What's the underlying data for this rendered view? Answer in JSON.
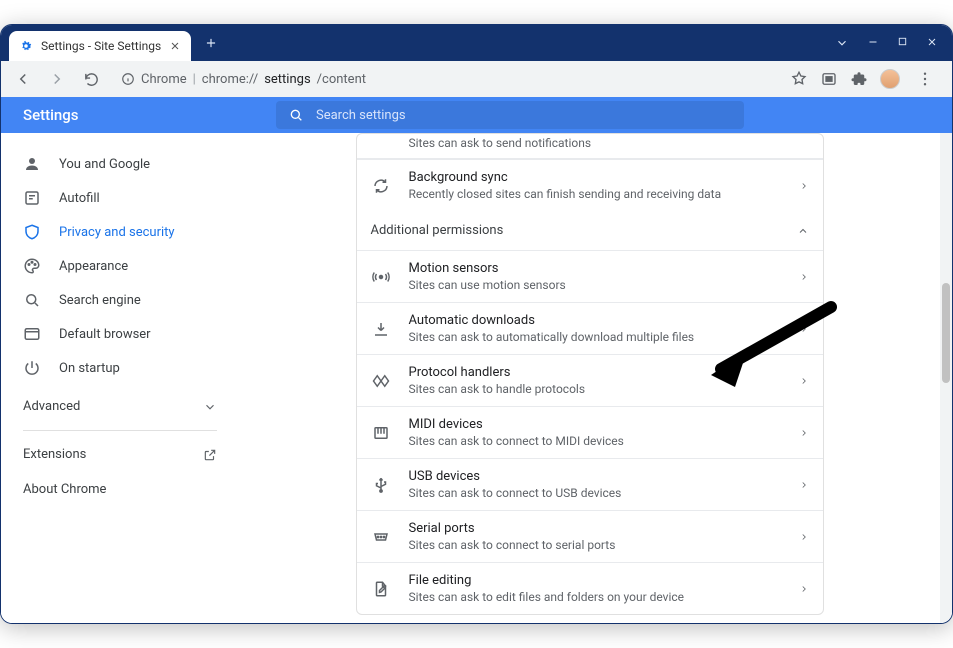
{
  "tab": {
    "title": "Settings - Site Settings"
  },
  "url": {
    "app": "Chrome",
    "path_visible": "chrome://",
    "path_emph": "settings",
    "path_tail": "/content"
  },
  "header": {
    "title": "Settings",
    "search_placeholder": "Search settings"
  },
  "sidebar": {
    "items": [
      {
        "label": "You and Google"
      },
      {
        "label": "Autofill"
      },
      {
        "label": "Privacy and security"
      },
      {
        "label": "Appearance"
      },
      {
        "label": "Search engine"
      },
      {
        "label": "Default browser"
      },
      {
        "label": "On startup"
      }
    ],
    "advanced": "Advanced",
    "extensions": "Extensions",
    "about": "About Chrome"
  },
  "content": {
    "truncated_sub": "Sites can ask to send notifications",
    "rows_top": [
      {
        "title": "Background sync",
        "sub": "Recently closed sites can finish sending and receiving data"
      }
    ],
    "section_header": "Additional permissions",
    "rows": [
      {
        "title": "Motion sensors",
        "sub": "Sites can use motion sensors"
      },
      {
        "title": "Automatic downloads",
        "sub": "Sites can ask to automatically download multiple files"
      },
      {
        "title": "Protocol handlers",
        "sub": "Sites can ask to handle protocols"
      },
      {
        "title": "MIDI devices",
        "sub": "Sites can ask to connect to MIDI devices"
      },
      {
        "title": "USB devices",
        "sub": "Sites can ask to connect to USB devices"
      },
      {
        "title": "Serial ports",
        "sub": "Sites can ask to connect to serial ports"
      },
      {
        "title": "File editing",
        "sub": "Sites can ask to edit files and folders on your device"
      }
    ]
  }
}
